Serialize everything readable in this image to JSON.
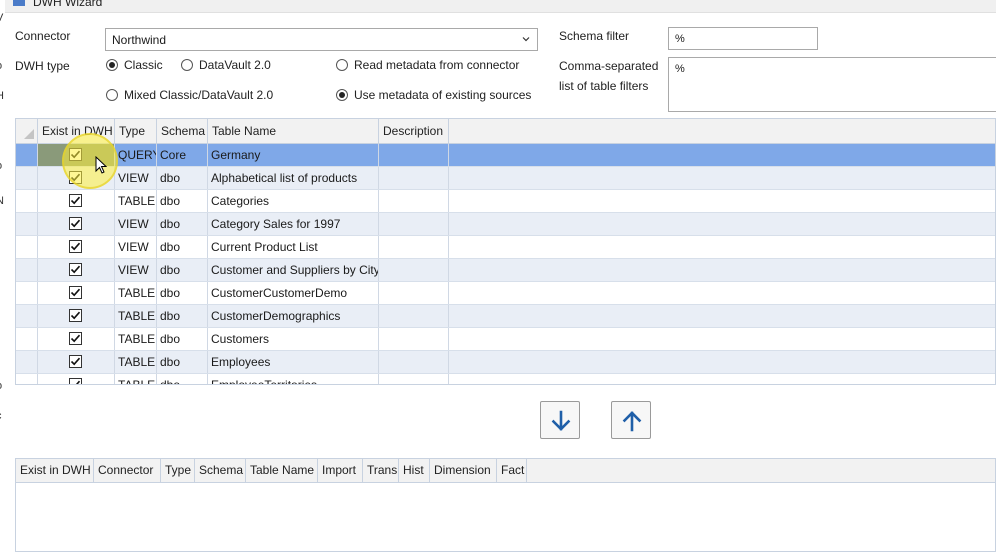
{
  "window": {
    "title": "DWH Wizard"
  },
  "left_strip": [
    "V",
    "o",
    "H",
    "o",
    "N",
    "o",
    "c"
  ],
  "connector": {
    "label": "Connector",
    "value": "Northwind"
  },
  "dwh_type": {
    "label": "DWH type",
    "options": [
      {
        "label": "Classic",
        "selected": true
      },
      {
        "label": "DataVault 2.0",
        "selected": false
      },
      {
        "label": "Mixed Classic/DataVault 2.0",
        "selected": false
      }
    ]
  },
  "metadata_source": {
    "options": [
      {
        "label": "Read metadata from connector",
        "selected": false
      },
      {
        "label": "Use metadata of existing sources",
        "selected": true
      }
    ]
  },
  "schema_filter": {
    "label": "Schema filter",
    "value": "%"
  },
  "table_filters": {
    "label_line1": "Comma-separated",
    "label_line2": "list of table filters",
    "value": "%"
  },
  "source_grid": {
    "columns": [
      "Exist in DWH",
      "Type",
      "Schema",
      "Table Name",
      "Description"
    ],
    "rows": [
      {
        "exist": true,
        "type": "QUERY",
        "schema": "Core",
        "name": "Germany",
        "description": "",
        "selected": true
      },
      {
        "exist": true,
        "type": "VIEW",
        "schema": "dbo",
        "name": "Alphabetical list of products",
        "description": ""
      },
      {
        "exist": true,
        "type": "TABLE",
        "schema": "dbo",
        "name": "Categories",
        "description": ""
      },
      {
        "exist": true,
        "type": "VIEW",
        "schema": "dbo",
        "name": "Category Sales for 1997",
        "description": ""
      },
      {
        "exist": true,
        "type": "VIEW",
        "schema": "dbo",
        "name": "Current Product List",
        "description": ""
      },
      {
        "exist": true,
        "type": "VIEW",
        "schema": "dbo",
        "name": "Customer and Suppliers by City",
        "description": ""
      },
      {
        "exist": true,
        "type": "TABLE",
        "schema": "dbo",
        "name": "CustomerCustomerDemo",
        "description": ""
      },
      {
        "exist": true,
        "type": "TABLE",
        "schema": "dbo",
        "name": "CustomerDemographics",
        "description": ""
      },
      {
        "exist": true,
        "type": "TABLE",
        "schema": "dbo",
        "name": "Customers",
        "description": ""
      },
      {
        "exist": true,
        "type": "TABLE",
        "schema": "dbo",
        "name": "Employees",
        "description": ""
      },
      {
        "exist": true,
        "type": "TABLE",
        "schema": "dbo",
        "name": "EmployeeTerritories",
        "description": ""
      }
    ]
  },
  "move_buttons": {
    "down_icon": "arrow-down-icon",
    "up_icon": "arrow-up-icon"
  },
  "target_grid": {
    "columns": [
      "Exist in DWH",
      "Connector",
      "Type",
      "Schema",
      "Table Name",
      "Import",
      "Trans",
      "Hist",
      "Dimension",
      "Fact"
    ]
  },
  "colors": {
    "selected_row": "#7fa8e8",
    "alt_row": "#e9eef6",
    "arrow": "#1f5fa8",
    "highlight": "#fff03c"
  }
}
